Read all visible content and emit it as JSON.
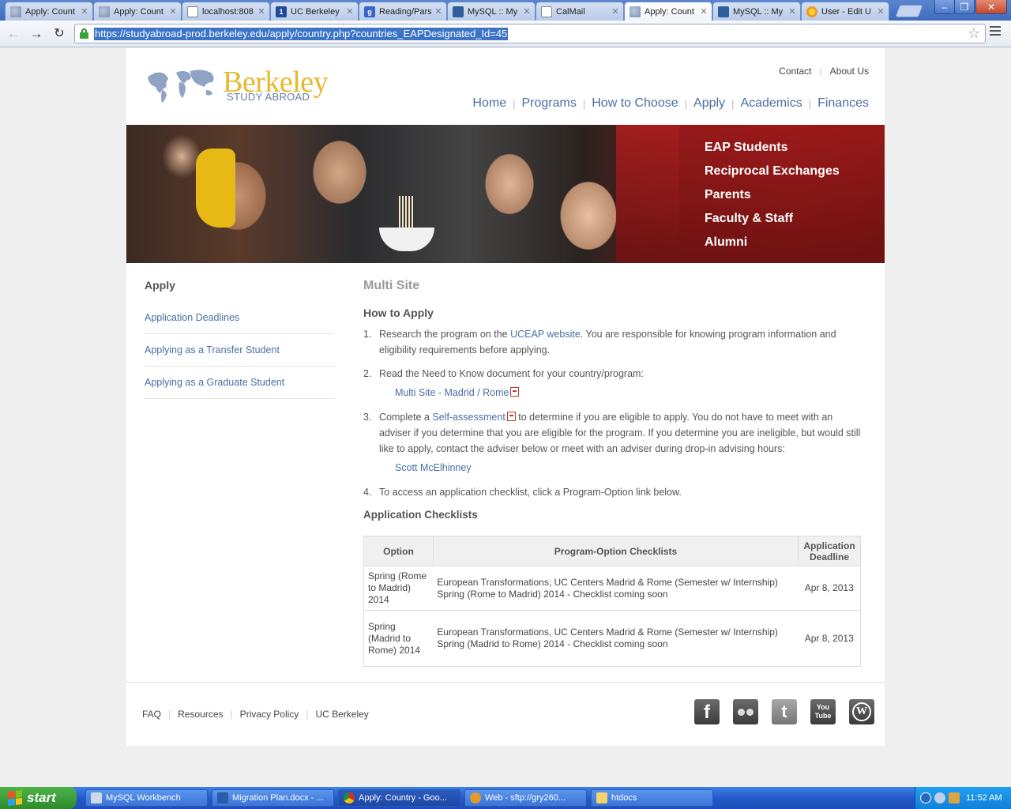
{
  "browser": {
    "tabs": [
      {
        "title": "Apply: Count",
        "icon": "globe-icon"
      },
      {
        "title": "Apply: Count",
        "icon": "globe-icon"
      },
      {
        "title": "localhost:808",
        "icon": "page-icon"
      },
      {
        "title": "UC Berkeley",
        "icon": "calendar-icon"
      },
      {
        "title": "Reading/Pars",
        "icon": "google-icon"
      },
      {
        "title": "MySQL :: My",
        "icon": "mysql-icon"
      },
      {
        "title": "CalMail",
        "icon": "page-icon"
      },
      {
        "title": "Apply: Count",
        "icon": "globe-icon",
        "active": true
      },
      {
        "title": "MySQL :: My",
        "icon": "mysql-icon"
      },
      {
        "title": "User - Edit U",
        "icon": "sun-icon"
      }
    ],
    "url": "https://studyabroad-prod.berkeley.edu/apply/country.php?countries_EAPDesignated_Id=45",
    "tab_one_glyph": "1",
    "tab_g_glyph": "g"
  },
  "site": {
    "logo_word": "Berkeley",
    "logo_sub": "STUDY ABROAD",
    "utility_nav": [
      "Contact",
      "About Us"
    ],
    "main_nav": [
      "Home",
      "Programs",
      "How to Choose",
      "Apply",
      "Academics",
      "Finances"
    ],
    "hero_nav": [
      "EAP Students",
      "Reciprocal Exchanges",
      "Parents",
      "Faculty & Staff",
      "Alumni"
    ],
    "brand_gold": "#e7b829",
    "link_blue": "#4a6fa5"
  },
  "sidebar": {
    "title": "Apply",
    "items": [
      "Application Deadlines",
      "Applying as a Transfer Student",
      "Applying as a Graduate Student"
    ]
  },
  "content": {
    "title": "Multi Site",
    "how_to_heading": "How to Apply",
    "steps": [
      {
        "num": "1.",
        "before": "Research the program on the ",
        "link": "UCEAP website",
        "after": ". You are responsible for knowing program information and eligibility requirements before applying."
      },
      {
        "num": "2.",
        "text": "Read the Need to Know document for your country/program:",
        "sublink": "Multi Site - Madrid / Rome"
      },
      {
        "num": "3.",
        "before": "Complete a ",
        "link": "Self-assessment",
        "after": " to determine if you are eligible to apply. You do not have to meet with an adviser if you determine that you are eligible for the program. If you determine you are ineligible, but would still like to apply, contact the adviser below or meet with an adviser during drop-in advising hours:",
        "sublink": "Scott McElhinney"
      },
      {
        "num": "4.",
        "text": "To access an application checklist, click a Program-Option link below."
      }
    ],
    "checklist_heading": "Application Checklists",
    "table": {
      "headers": [
        "Option",
        "Program-Option Checklists",
        "Application Deadline"
      ],
      "rows": [
        {
          "option": "Spring (Rome to Madrid) 2014",
          "line1": "European Transformations, UC Centers Madrid & Rome (Semester w/ Internship)",
          "line2": "Spring (Rome to Madrid) 2014 - Checklist coming soon",
          "deadline": "Apr 8, 2013"
        },
        {
          "option": "Spring (Madrid to Rome) 2014",
          "line1": "European Transformations, UC Centers Madrid & Rome (Semester w/ Internship)",
          "line2": "Spring (Madrid to Rome) 2014 - Checklist coming soon",
          "deadline": "Apr 8, 2013"
        }
      ]
    }
  },
  "footer": {
    "links": [
      "FAQ",
      "Resources",
      "Privacy Policy",
      "UC Berkeley"
    ],
    "social": [
      "facebook-icon",
      "flickr-icon",
      "twitter-icon",
      "youtube-icon",
      "wordpress-icon"
    ],
    "facebook_glyph": "f",
    "twitter_glyph": "t",
    "youtube_line1": "You",
    "youtube_line2": "Tube",
    "wordpress_glyph": "W"
  },
  "taskbar": {
    "start_label": "start",
    "tasks": [
      {
        "label": "MySQL Workbench",
        "icon": "mysql-workbench-icon"
      },
      {
        "label": "Migration Plan.docx - ...",
        "icon": "word-icon"
      },
      {
        "label": "Apply: Country - Goo...",
        "icon": "chrome-icon",
        "active": true
      },
      {
        "label": "Web - sftp://gry260...",
        "icon": "gear-icon"
      },
      {
        "label": "htdocs",
        "icon": "folder-icon"
      }
    ],
    "clock": "11:52 AM"
  }
}
